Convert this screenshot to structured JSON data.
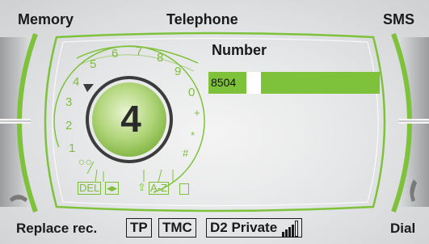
{
  "header": {
    "left": "Memory",
    "center": "Telephone",
    "right": "SMS"
  },
  "number": {
    "title": "Number",
    "value": "8504"
  },
  "dial": {
    "selected": "4",
    "digits": [
      "1",
      "2",
      "3",
      "4",
      "5",
      "6",
      "7",
      "8",
      "9",
      "0"
    ],
    "symbols": [
      "+",
      "*",
      "#"
    ],
    "options": [
      "DEL",
      "◂▸",
      "A-Z"
    ]
  },
  "footer": {
    "replace": "Replace rec.",
    "tp": "TP",
    "tmc": "TMC",
    "network": "D2 Private",
    "dial": "Dial"
  },
  "colors": {
    "accent_green": "#7dc23a"
  }
}
